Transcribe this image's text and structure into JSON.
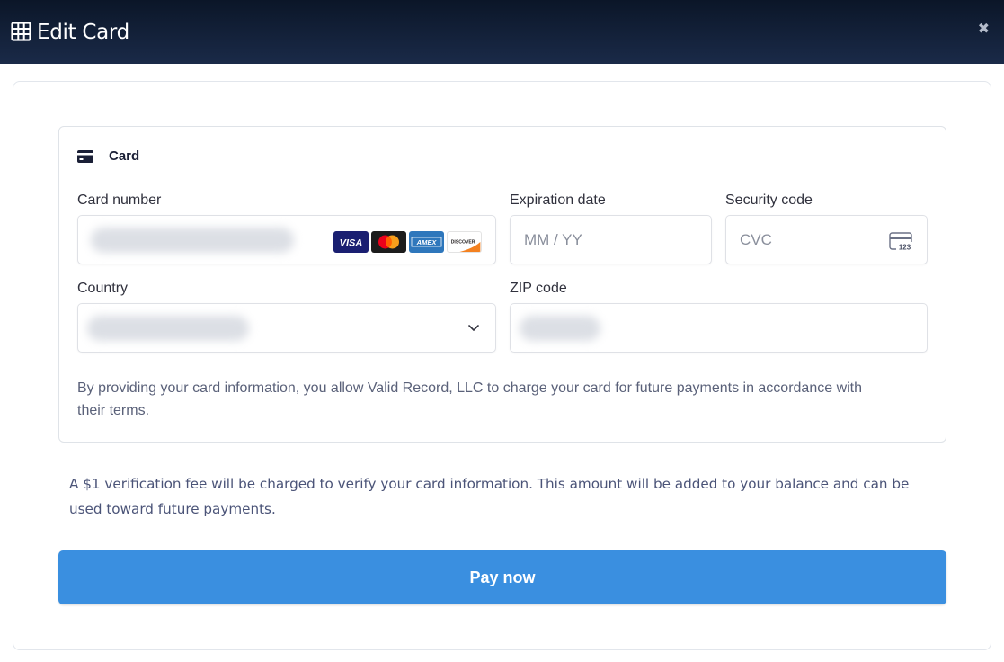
{
  "window": {
    "title": "Edit Card",
    "close_symbol": "✖"
  },
  "card_section": {
    "heading": "Card",
    "card_number": {
      "label": "Card number",
      "brands": [
        "VISA",
        "mastercard",
        "AMEX",
        "DISCOVER"
      ]
    },
    "expiration": {
      "label": "Expiration date",
      "placeholder": "MM / YY"
    },
    "security": {
      "label": "Security code",
      "placeholder": "CVC",
      "icon_text": "123"
    },
    "country": {
      "label": "Country"
    },
    "zip": {
      "label": "ZIP code"
    },
    "consent": "By providing your card information, you allow Valid Record, LLC to charge your card for future payments in accordance with their terms."
  },
  "fee_note": "A $1 verification fee will be charged to verify your card information. This amount will be added to your balance and can be used toward future payments.",
  "pay_button": "Pay now",
  "colors": {
    "titlebar": "#0b1628",
    "accent": "#3a8fe0",
    "visa": "#1a1f71",
    "amex": "#2e77bc",
    "mastercard_red": "#eb001b",
    "mastercard_yellow": "#f79e1b"
  }
}
